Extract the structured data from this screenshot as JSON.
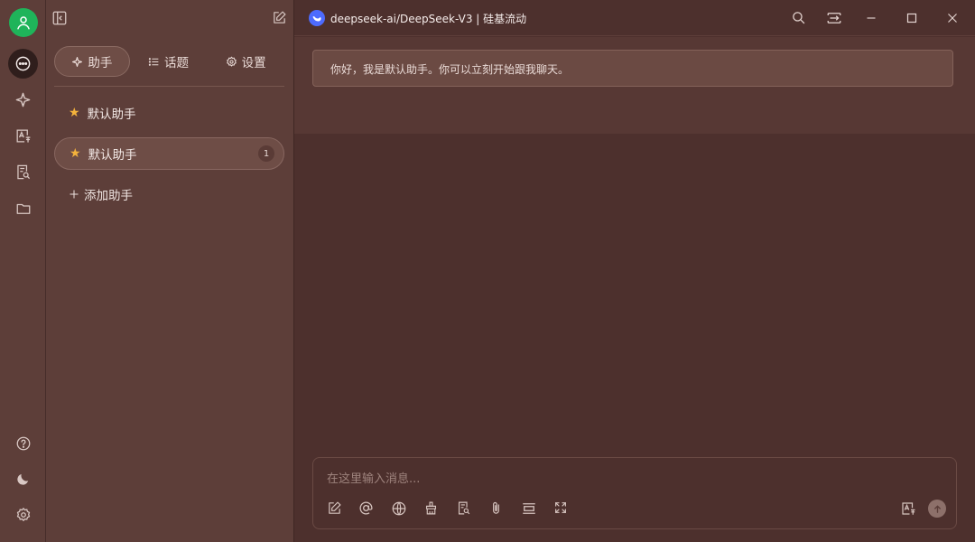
{
  "window": {
    "model_title": "deepseek-ai/DeepSeek-V3 | 硅基流动"
  },
  "rail": {
    "items": [
      {
        "name": "chat-icon",
        "active": true
      },
      {
        "name": "sparkle-icon"
      },
      {
        "name": "translate-icon"
      },
      {
        "name": "document-search-icon"
      },
      {
        "name": "folder-icon"
      }
    ],
    "bottom": [
      "help-icon",
      "moon-icon",
      "gear-icon"
    ]
  },
  "sidebar": {
    "tabs": [
      {
        "label": "助手",
        "icon": "sparkle-icon",
        "active": true
      },
      {
        "label": "话题",
        "icon": "list-icon"
      },
      {
        "label": "设置",
        "icon": "gear-icon"
      }
    ],
    "assistants": [
      {
        "label": "默认助手"
      },
      {
        "label": "默认助手",
        "selected": true,
        "count": "1"
      }
    ],
    "add_label": "添加助手"
  },
  "chat": {
    "welcome": "你好，我是默认助手。你可以立刻开始跟我聊天。"
  },
  "input": {
    "placeholder": "在这里输入消息...",
    "tools": [
      "new-topic-icon",
      "mention-icon",
      "web-search-icon",
      "broom-icon",
      "knowledge-base-icon",
      "attachment-icon",
      "collapse-icon",
      "expand-icon"
    ]
  },
  "colors": {
    "accent_avatar": "#1fb45a",
    "model_logo": "#4d6bfe",
    "star": "#f4b33c"
  }
}
